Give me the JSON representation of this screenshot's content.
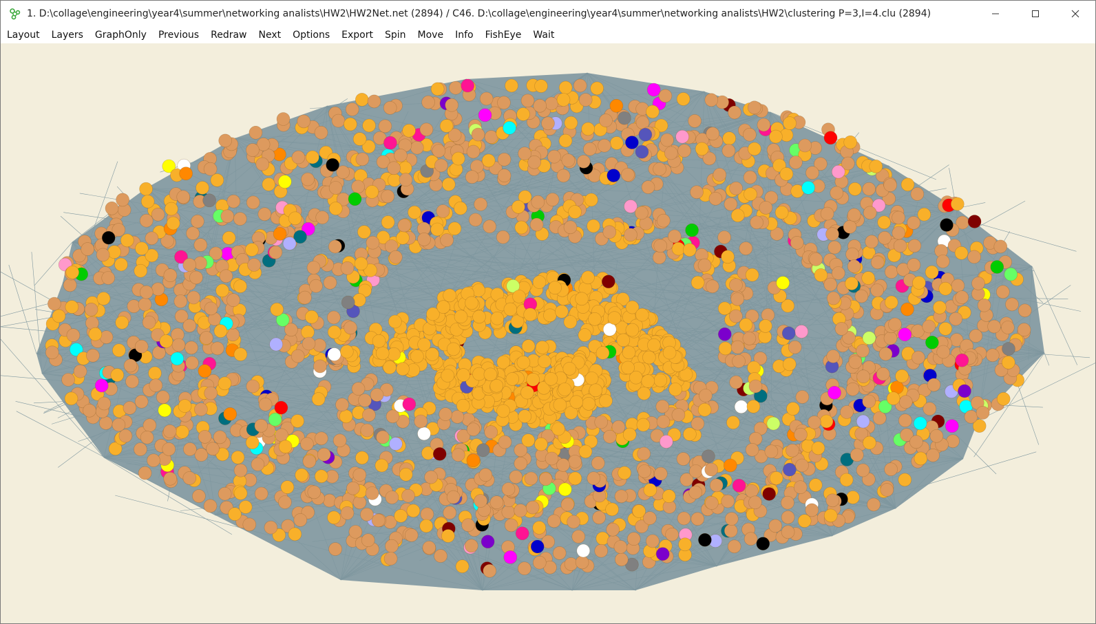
{
  "window": {
    "title": "1. D:\\collage\\engineering\\year4\\summer\\networking analists\\HW2\\HW2Net.net (2894) / C46. D:\\collage\\engineering\\year4\\summer\\networking analists\\HW2\\clustering P=3,I=4.clu (2894)",
    "app_icon": "pajek-icon",
    "controls": [
      "minimize-icon",
      "maximize-icon",
      "close-icon"
    ]
  },
  "menu": {
    "items": [
      "Layout",
      "Layers",
      "GraphOnly",
      "Previous",
      "Redraw",
      "Next",
      "Options",
      "Export",
      "Spin",
      "Move",
      "Info",
      "FishEye",
      "Wait"
    ]
  },
  "canvas": {
    "background_color": "#f3eedc",
    "edge_fill_color": "#8a9fa6",
    "edge_line_color": "#7f979f",
    "dominant_vertex_colors": [
      "#dd9a5e",
      "#f8b02a"
    ],
    "cluster_vertex_colors": [
      "#ff0000",
      "#ff00ff",
      "#0000cc",
      "#00cc00",
      "#000000",
      "#7f0000",
      "#ffff00",
      "#00ffff",
      "#7b00cc",
      "#808080",
      "#006e7f",
      "#ff8800",
      "#b0b0ff",
      "#ccff66",
      "#ffffff",
      "#ff99cc",
      "#5555bb",
      "#ff1493",
      "#66ff66"
    ]
  }
}
